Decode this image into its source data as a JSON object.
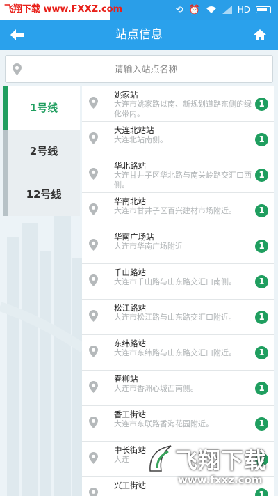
{
  "status_bar": {
    "watermark": "飞翔下载 www.FXXZ.com",
    "network": "HD"
  },
  "header": {
    "title": "站点信息"
  },
  "search": {
    "placeholder": "请输入站点名称"
  },
  "lines": [
    {
      "label": "1号线",
      "active": true
    },
    {
      "label": "2号线",
      "active": false
    },
    {
      "label": "12号线",
      "active": false
    }
  ],
  "stations": [
    {
      "name": "姚家站",
      "address": "大连市姚家路以南、新规划道路东侧的绿化带内。",
      "line": "1"
    },
    {
      "name": "大连北站站",
      "address": "大连北站南侧。",
      "line": "1"
    },
    {
      "name": "华北路站",
      "address": "大连甘井子区华北路与南关岭路交汇口西侧。",
      "line": "1"
    },
    {
      "name": "华南北站",
      "address": "大连市甘井子区百兴建材市场附近。",
      "line": "1"
    },
    {
      "name": "华南广场站",
      "address": "大连市华南广场附近",
      "line": "1"
    },
    {
      "name": "千山路站",
      "address": "大连市千山路与山东路交汇口南侧。",
      "line": "1"
    },
    {
      "name": "松江路站",
      "address": "大连市松江路与山东路交汇口附近。",
      "line": "1"
    },
    {
      "name": "东纬路站",
      "address": "大连市东纬路与山东路交汇口附近。",
      "line": "1"
    },
    {
      "name": "春柳站",
      "address": "大连市香洲心城西南侧。",
      "line": "1"
    },
    {
      "name": "香工街站",
      "address": "大连市东联路香海花园附近。",
      "line": "1"
    },
    {
      "name": "中长街站",
      "address": "大连",
      "line": "1"
    },
    {
      "name": "兴工街站",
      "address": "",
      "line": "1"
    }
  ],
  "watermark_bottom": {
    "text": "飞翔下载",
    "url": "www.fxxz.com"
  },
  "colors": {
    "header": "#2aa1ec",
    "active_line": "#1f9e5f",
    "badge": "#1f9e5f"
  }
}
